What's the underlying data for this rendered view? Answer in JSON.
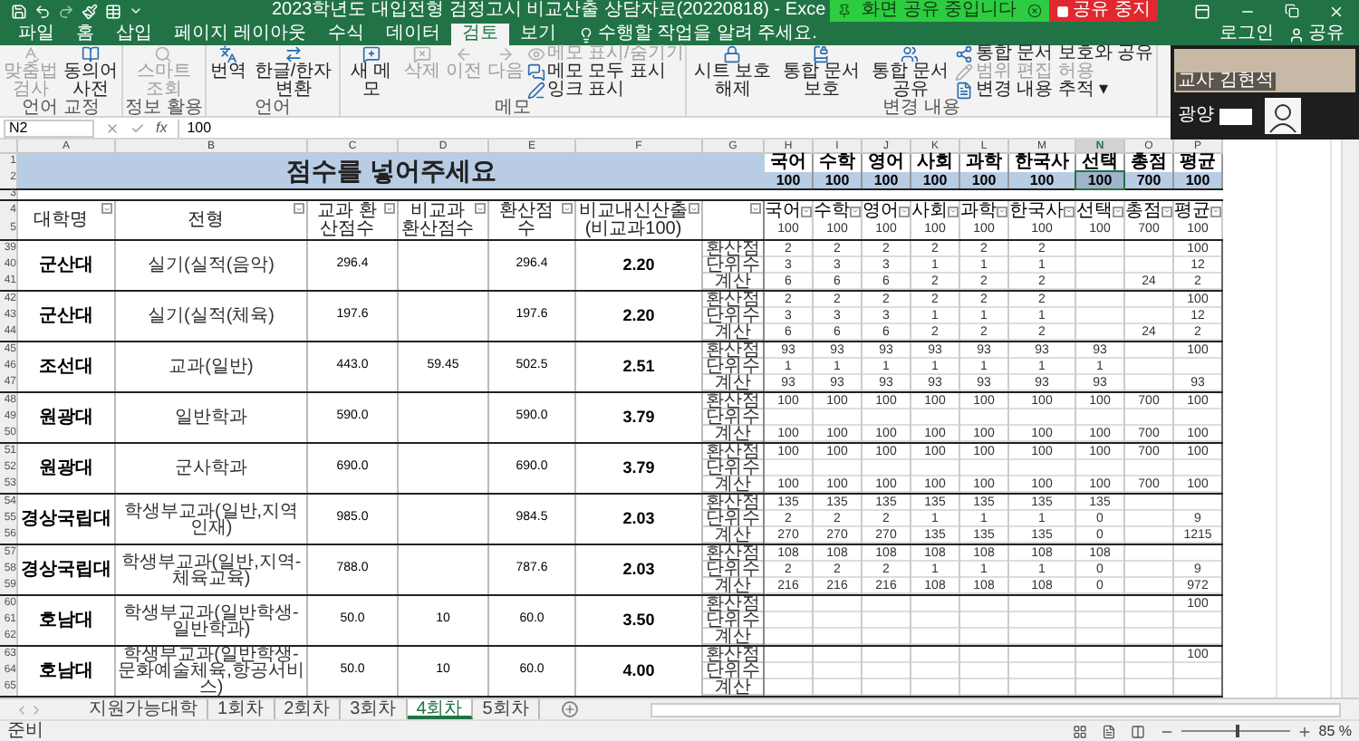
{
  "title_bar": {
    "title": "2023학년도 대입전형 검정고시 비교산출 상담자료(20220818) - Exce"
  },
  "share_banner": {
    "message": "화면 공유 중입니다",
    "stop": "공유 중지"
  },
  "menu_tabs": [
    {
      "label": "파일",
      "selected": false
    },
    {
      "label": "홈",
      "selected": false
    },
    {
      "label": "삽입",
      "selected": false
    },
    {
      "label": "페이지 레이아웃",
      "selected": false
    },
    {
      "label": "수식",
      "selected": false
    },
    {
      "label": "데이터",
      "selected": false
    },
    {
      "label": "검토",
      "selected": true
    },
    {
      "label": "보기",
      "selected": false
    }
  ],
  "tell_me": "수행할 작업을 알려 주세요.",
  "account": {
    "sign_in": "로그인",
    "share": "공유"
  },
  "ribbon": [
    {
      "label": "언어 교정",
      "items": [
        {
          "kind": "large",
          "label": "맞춤법 검사",
          "disabled": true
        },
        {
          "kind": "large",
          "label": "동의어 사전",
          "disabled": false
        }
      ]
    },
    {
      "label": "정보 활용",
      "items": [
        {
          "kind": "large",
          "label": "스마트 조회",
          "disabled": true
        }
      ]
    },
    {
      "label": "언어",
      "items": [
        {
          "kind": "large",
          "label": "번역",
          "disabled": false
        },
        {
          "kind": "large",
          "label": "한글/한자 변환",
          "disabled": false
        }
      ]
    },
    {
      "label": "메모",
      "items": [
        {
          "kind": "large",
          "label": "새 메모",
          "disabled": false
        },
        {
          "kind": "large",
          "label": "삭제",
          "disabled": true
        },
        {
          "kind": "large",
          "label": "이전",
          "disabled": true
        },
        {
          "kind": "large",
          "label": "다음",
          "disabled": true
        },
        {
          "kind": "small",
          "label": "메모 표시/숨기기",
          "disabled": true
        },
        {
          "kind": "small",
          "label": "메모 모두 표시",
          "disabled": false
        },
        {
          "kind": "small",
          "label": "잉크 표시",
          "disabled": false
        }
      ]
    },
    {
      "label": "변경 내용",
      "items": [
        {
          "kind": "large",
          "label": "시트 보호 해제",
          "disabled": false
        },
        {
          "kind": "large",
          "label": "통합 문서 보호",
          "disabled": false
        },
        {
          "kind": "large",
          "label": "통합 문서 공유",
          "disabled": false
        },
        {
          "kind": "small",
          "label": "통합 문서 보호와 공유",
          "disabled": false
        },
        {
          "kind": "small",
          "label": "범위 편집 허용",
          "disabled": true
        },
        {
          "kind": "small",
          "label": "변경 내용 추적 ▾",
          "disabled": false
        }
      ]
    }
  ],
  "formula_bar": {
    "name_box": "N2",
    "function_label": "fx",
    "value": "100"
  },
  "columns": [
    {
      "label": "A",
      "selected": false
    },
    {
      "label": "B",
      "selected": false
    },
    {
      "label": "C",
      "selected": false
    },
    {
      "label": "D",
      "selected": false
    },
    {
      "label": "E",
      "selected": false
    },
    {
      "label": "F",
      "selected": false
    },
    {
      "label": "G",
      "selected": false
    },
    {
      "label": "H",
      "selected": false
    },
    {
      "label": "I",
      "selected": false
    },
    {
      "label": "J",
      "selected": false
    },
    {
      "label": "K",
      "selected": false
    },
    {
      "label": "L",
      "selected": false
    },
    {
      "label": "M",
      "selected": false
    },
    {
      "label": "N",
      "selected": true
    },
    {
      "label": "O",
      "selected": false
    },
    {
      "label": "P",
      "selected": false
    }
  ],
  "header_row_numbers": [
    "1",
    "2",
    "3",
    "4",
    "5"
  ],
  "score_header": {
    "title": "점수를 넣어주세요",
    "subjects": [
      {
        "label": "국어",
        "max": "100",
        "selected": false
      },
      {
        "label": "수학",
        "max": "100",
        "selected": false
      },
      {
        "label": "영어",
        "max": "100",
        "selected": false
      },
      {
        "label": "사회",
        "max": "100",
        "selected": false
      },
      {
        "label": "과학",
        "max": "100",
        "selected": false
      },
      {
        "label": "한국사",
        "max": "100",
        "selected": false
      },
      {
        "label": "선택",
        "max": "100",
        "selected": true
      },
      {
        "label": "총점",
        "max": "700",
        "selected": false
      },
      {
        "label": "평균",
        "max": "100",
        "selected": false
      }
    ]
  },
  "table_columns": [
    "대학명",
    "전형",
    "교과 환산점수",
    "비교과 환산점수",
    "환산점수",
    "비교내신산출 (비교과100)"
  ],
  "subject_columns": [
    {
      "label": "국어",
      "max": "100"
    },
    {
      "label": "수학",
      "max": "100"
    },
    {
      "label": "영어",
      "max": "100"
    },
    {
      "label": "사회",
      "max": "100"
    },
    {
      "label": "과학",
      "max": "100"
    },
    {
      "label": "한국사",
      "max": "100"
    },
    {
      "label": "선택",
      "max": "100"
    },
    {
      "label": "총점",
      "max": "700"
    },
    {
      "label": "평균",
      "max": "100"
    }
  ],
  "blocks": [
    {
      "row_numbers": [
        "39",
        "40",
        "41"
      ],
      "university": "군산대",
      "admission": "실기(실적(음악)",
      "subject_score": "296.4",
      "total_score": "296.4",
      "grade": "2.20",
      "sub_rows": [
        {
          "label": "환산점",
          "values": {
            "korean": "2",
            "math": "2",
            "english": "2",
            "social": "2",
            "science": "2",
            "history": "2",
            "average": "100"
          }
        },
        {
          "label": "단위수",
          "values": {
            "korean": "3",
            "math": "3",
            "english": "3",
            "social": "1",
            "science": "1",
            "history": "1",
            "average": "12"
          }
        },
        {
          "label": "계산",
          "values": {
            "korean": "6",
            "math": "6",
            "english": "6",
            "social": "2",
            "science": "2",
            "history": "2",
            "total": "24",
            "average": "2"
          }
        }
      ]
    },
    {
      "row_numbers": [
        "42",
        "43",
        "44"
      ],
      "university": "군산대",
      "admission": "실기(실적(체육)",
      "subject_score": "197.6",
      "total_score": "197.6",
      "grade": "2.20",
      "sub_rows": [
        {
          "label": "환산점",
          "values": {
            "korean": "2",
            "math": "2",
            "english": "2",
            "social": "2",
            "science": "2",
            "history": "2",
            "average": "100"
          }
        },
        {
          "label": "단위수",
          "values": {
            "korean": "3",
            "math": "3",
            "english": "3",
            "social": "1",
            "science": "1",
            "history": "1",
            "average": "12"
          }
        },
        {
          "label": "계산",
          "values": {
            "korean": "6",
            "math": "6",
            "english": "6",
            "social": "2",
            "science": "2",
            "history": "2",
            "total": "24",
            "average": "2"
          }
        }
      ]
    },
    {
      "row_numbers": [
        "45",
        "46",
        "47"
      ],
      "university": "조선대",
      "admission": "교과(일반)",
      "subject_score": "443.0",
      "extra_score": "59.45",
      "total_score": "502.5",
      "grade": "2.51",
      "sub_rows": [
        {
          "label": "환산점",
          "values": {
            "korean": "93",
            "math": "93",
            "english": "93",
            "social": "93",
            "science": "93",
            "history": "93",
            "elective": "93",
            "average": "100"
          }
        },
        {
          "label": "단위수",
          "values": {
            "korean": "1",
            "math": "1",
            "english": "1",
            "social": "1",
            "science": "1",
            "history": "1",
            "elective": "1"
          }
        },
        {
          "label": "계산",
          "values": {
            "korean": "93",
            "math": "93",
            "english": "93",
            "social": "93",
            "science": "93",
            "history": "93",
            "elective": "93",
            "average": "93"
          }
        }
      ]
    },
    {
      "row_numbers": [
        "48",
        "49",
        "50"
      ],
      "university": "원광대",
      "admission": "일반학과",
      "subject_score": "590.0",
      "total_score": "590.0",
      "grade": "3.79",
      "sub_rows": [
        {
          "label": "환산점",
          "values": {
            "korean": "100",
            "math": "100",
            "english": "100",
            "social": "100",
            "science": "100",
            "history": "100",
            "elective": "100",
            "total": "700",
            "average": "100"
          }
        },
        {
          "label": "단위수"
        },
        {
          "label": "계산",
          "values": {
            "korean": "100",
            "math": "100",
            "english": "100",
            "social": "100",
            "science": "100",
            "history": "100",
            "elective": "100",
            "total": "700",
            "average": "100"
          }
        }
      ]
    },
    {
      "row_numbers": [
        "51",
        "52",
        "53"
      ],
      "university": "원광대",
      "admission": "군사학과",
      "subject_score": "690.0",
      "total_score": "690.0",
      "grade": "3.79",
      "sub_rows": [
        {
          "label": "환산점",
          "values": {
            "korean": "100",
            "math": "100",
            "english": "100",
            "social": "100",
            "science": "100",
            "history": "100",
            "elective": "100",
            "total": "700",
            "average": "100"
          }
        },
        {
          "label": "단위수"
        },
        {
          "label": "계산",
          "values": {
            "korean": "100",
            "math": "100",
            "english": "100",
            "social": "100",
            "science": "100",
            "history": "100",
            "elective": "100",
            "total": "700",
            "average": "100"
          }
        }
      ]
    },
    {
      "row_numbers": [
        "54",
        "55",
        "56"
      ],
      "university": "경상국립대",
      "admission": "학생부교과(일반,지역인재)",
      "subject_score": "985.0",
      "total_score": "984.5",
      "grade": "2.03",
      "sub_rows": [
        {
          "label": "환산점",
          "values": {
            "korean": "135",
            "math": "135",
            "english": "135",
            "social": "135",
            "science": "135",
            "history": "135",
            "elective": "135"
          }
        },
        {
          "label": "단위수",
          "values": {
            "korean": "2",
            "math": "2",
            "english": "2",
            "social": "1",
            "science": "1",
            "history": "1",
            "elective": "0",
            "average": "9"
          }
        },
        {
          "label": "계산",
          "values": {
            "korean": "270",
            "math": "270",
            "english": "270",
            "social": "135",
            "science": "135",
            "history": "135",
            "elective": "0",
            "average": "1215"
          }
        }
      ]
    },
    {
      "row_numbers": [
        "57",
        "58",
        "59"
      ],
      "university": "경상국립대",
      "admission": "학생부교과(일반,지역-체육교육)",
      "subject_score": "788.0",
      "total_score": "787.6",
      "grade": "2.03",
      "sub_rows": [
        {
          "label": "환산점",
          "values": {
            "korean": "108",
            "math": "108",
            "english": "108",
            "social": "108",
            "science": "108",
            "history": "108",
            "elective": "108"
          }
        },
        {
          "label": "단위수",
          "values": {
            "korean": "2",
            "math": "2",
            "english": "2",
            "social": "1",
            "science": "1",
            "history": "1",
            "elective": "0",
            "average": "9"
          }
        },
        {
          "label": "계산",
          "values": {
            "korean": "216",
            "math": "216",
            "english": "216",
            "social": "108",
            "science": "108",
            "history": "108",
            "elective": "0",
            "average": "972"
          }
        }
      ]
    },
    {
      "row_numbers": [
        "60",
        "61",
        "62"
      ],
      "university": "호남대",
      "admission": "학생부교과(일반학생-일반학과)",
      "subject_score": "50.0",
      "extra_score": "10",
      "total_score": "60.0",
      "grade": "3.50",
      "sub_rows": [
        {
          "label": "환산점",
          "values": {
            "average": "100"
          }
        },
        {
          "label": "단위수"
        },
        {
          "label": "계산"
        }
      ]
    },
    {
      "row_numbers": [
        "63",
        "64",
        "65"
      ],
      "university": "호남대",
      "admission": "학생부교과(일반학생-문화예술체육,항공서비스)",
      "subject_score": "50.0",
      "extra_score": "10",
      "total_score": "60.0",
      "grade": "4.00",
      "sub_rows": [
        {
          "label": "환산점",
          "values": {
            "average": "100"
          }
        },
        {
          "label": "단위수"
        },
        {
          "label": "계산"
        }
      ]
    }
  ],
  "sheet_tabs": [
    {
      "label": "지원가능대학",
      "selected": false
    },
    {
      "label": "1회차",
      "selected": false
    },
    {
      "label": "2회차",
      "selected": false
    },
    {
      "label": "3회차",
      "selected": false
    },
    {
      "label": "4회차",
      "selected": true
    },
    {
      "label": "5회차",
      "selected": false
    }
  ],
  "status_bar": {
    "status": "준비",
    "zoom": "85 %",
    "zoom_level": {
      "level": 0.5
    }
  },
  "participants": [
    {
      "kind": "video",
      "name": "교사 김현석"
    },
    {
      "kind": "avatar",
      "name": "광양"
    }
  ]
}
